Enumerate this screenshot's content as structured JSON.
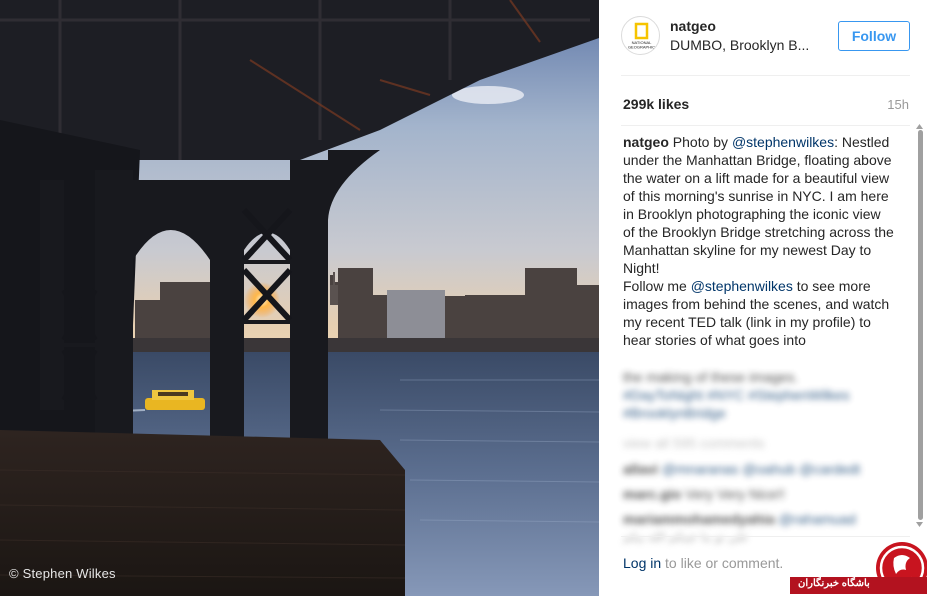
{
  "photo": {
    "credit": "© Stephen Wilkes"
  },
  "post": {
    "username": "natgeo",
    "location": "DUMBO, Brooklyn B...",
    "follow_label": "Follow",
    "likes": "299k likes",
    "time_ago": "15h",
    "avatar_logo_text": "NATIONAL GEOGRAPHIC"
  },
  "caption": {
    "username": "natgeo",
    "text_1": " Photo by ",
    "mention_1": "@stephenwilkes",
    "text_2": ": Nestled under the Manhattan Bridge, floating above the water on a lift made for a beautiful view of this morning's sunrise in NYC. I am here in Brooklyn photographing the iconic view of the Brooklyn Bridge stretching across the Manhattan skyline for my newest Day to Night!",
    "text_3": "Follow me ",
    "mention_2": "@stephenwilkes",
    "text_4": " to see more images from behind the scenes, and watch my recent TED talk (link in my profile) to hear stories of what goes into",
    "blurred_line_1": "the making of these images.",
    "blurred_hashtags_1": "#DayToNight #NYC #StephenWilkes",
    "blurred_hashtags_2": "#BrooklynBridge",
    "blurred_view_all": "view all 595 comments",
    "blurred_comment_1_user": "allavi",
    "blurred_comment_1_text": " @mnaranas @oahub @cardedt",
    "blurred_comment_2_user": "marc.gio",
    "blurred_comment_2_text": " Very Very Nice!!",
    "blurred_comment_3_user": "mariammohamedyahia",
    "blurred_comment_3_text": " @rahamuad",
    "blurred_comment_3_sub": "علي تو بنا عينكم الله بيكم"
  },
  "footer": {
    "login_link": "Log in",
    "login_rest": " to like or comment."
  },
  "watermark": {
    "text": "باشگاه خبرنگاران"
  },
  "colors": {
    "accent": "#3897f0",
    "link": "#003569",
    "muted": "#999999",
    "watermark_red": "#b3121f"
  }
}
